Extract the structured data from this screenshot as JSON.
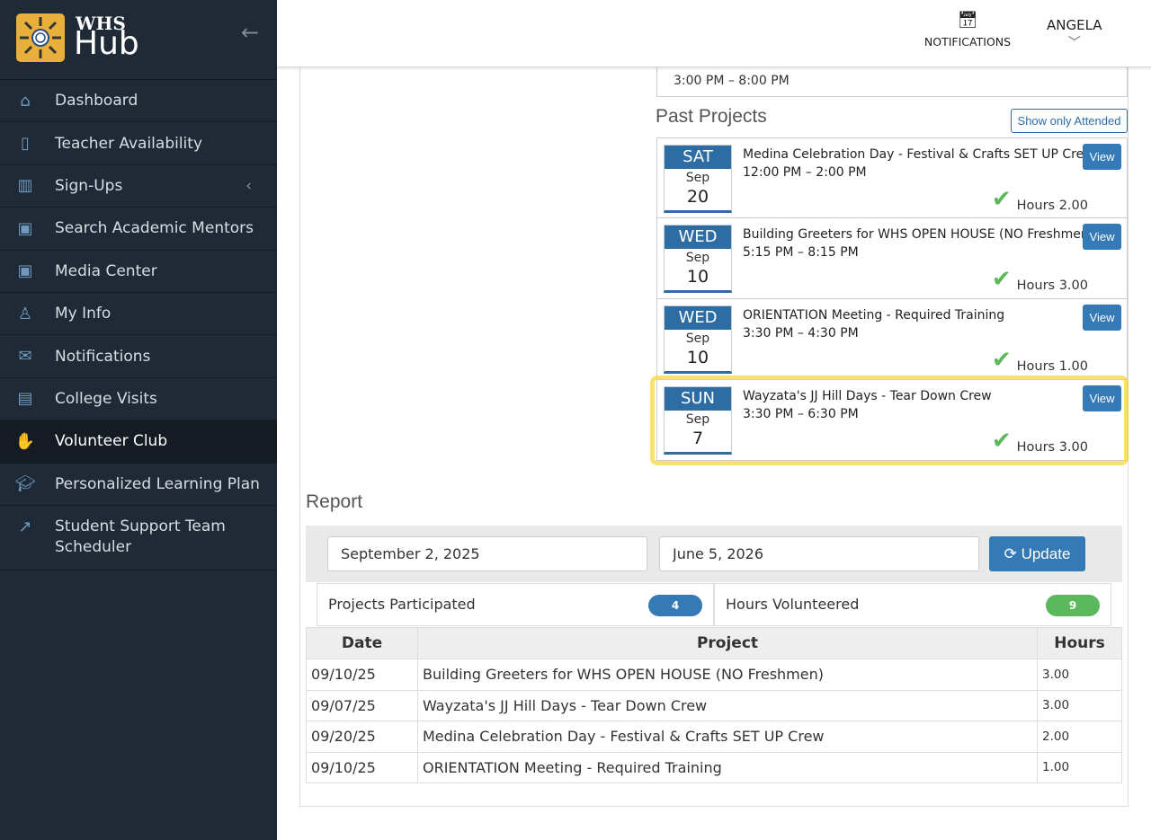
{
  "brand": {
    "line1": "WHS",
    "line2": "Hub"
  },
  "sidebar": {
    "items": [
      {
        "label": "Dashboard",
        "icon": "home-icon"
      },
      {
        "label": "Teacher Availability",
        "icon": "clipboard-icon"
      },
      {
        "label": "Sign-Ups",
        "icon": "map-icon"
      },
      {
        "label": "Search Academic Mentors",
        "icon": "calendar-icon"
      },
      {
        "label": "Media Center",
        "icon": "calendar-icon"
      },
      {
        "label": "My Info",
        "icon": "user-icon"
      },
      {
        "label": "Notifications",
        "icon": "envelope-icon"
      },
      {
        "label": "College Visits",
        "icon": "briefcase-icon"
      },
      {
        "label": "Volunteer Club",
        "icon": "hand-icon"
      },
      {
        "label": "Personalized Learning Plan",
        "icon": "graduation-cap-icon"
      },
      {
        "label": "Student Support Team Scheduler",
        "icon": "external-link-icon"
      }
    ]
  },
  "header": {
    "notifications": "NOTIFICATIONS",
    "user": "ANGELA"
  },
  "previous": {
    "time": "3:00 PM – 8:00 PM"
  },
  "past": {
    "title": "Past Projects",
    "filter": "Show only Attended",
    "view": "View",
    "hours_label": "Hours",
    "items": [
      {
        "dow": "SAT",
        "month": "Sep",
        "day": "20",
        "name": "Medina Celebration Day - Festival & Crafts SET UP Crew",
        "time": "12:00 PM – 2:00 PM",
        "hours": "2.00"
      },
      {
        "dow": "WED",
        "month": "Sep",
        "day": "10",
        "name": "Building Greeters for WHS OPEN HOUSE (NO Freshmen)",
        "time": "5:15 PM – 8:15 PM",
        "hours": "3.00"
      },
      {
        "dow": "WED",
        "month": "Sep",
        "day": "10",
        "name": "ORIENTATION Meeting - Required Training",
        "time": "3:30 PM – 4:30 PM",
        "hours": "1.00"
      },
      {
        "dow": "SUN",
        "month": "Sep",
        "day": "7",
        "name": "Wayzata's JJ Hill Days - Tear Down Crew",
        "time": "3:30 PM – 6:30 PM",
        "hours": "3.00"
      }
    ]
  },
  "report": {
    "title": "Report",
    "start": "September 2, 2025",
    "end": "June 5, 2026",
    "update": "Update",
    "projects_label": "Projects Participated",
    "projects_count": "4",
    "hours_label": "Hours Volunteered",
    "hours_count": "9",
    "colors": {
      "projects_badge": "#337ab7",
      "hours_badge": "#5cb85c"
    },
    "columns": [
      "Date",
      "Project",
      "Hours"
    ],
    "rows": [
      [
        "09/10/25",
        "Building Greeters for WHS OPEN HOUSE (NO Freshmen)",
        "3.00"
      ],
      [
        "09/07/25",
        "Wayzata's JJ Hill Days - Tear Down Crew",
        "3.00"
      ],
      [
        "09/20/25",
        "Medina Celebration Day - Festival & Crafts SET UP Crew",
        "2.00"
      ],
      [
        "09/10/25",
        "ORIENTATION Meeting - Required Training",
        "1.00"
      ]
    ]
  }
}
